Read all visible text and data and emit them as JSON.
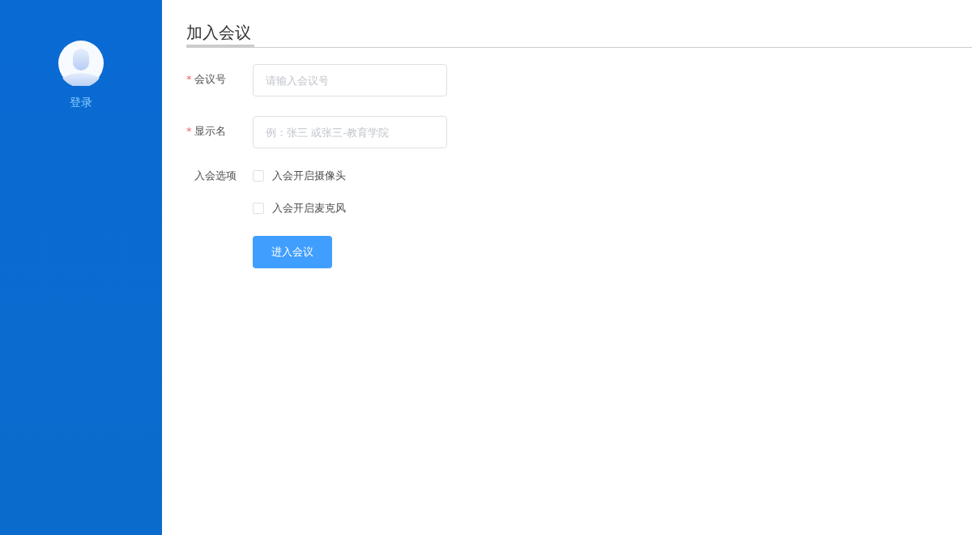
{
  "sidebar": {
    "login_label": "登录"
  },
  "page": {
    "title": "加入会议"
  },
  "fields": [
    {
      "mark": "*",
      "label": "会议号",
      "placeholder": "请输入会议号"
    },
    {
      "mark": "*",
      "label": "显示名",
      "placeholder": "例：张三 或张三-教育学院"
    }
  ],
  "options": {
    "label": "入会选项",
    "items": [
      {
        "label": "入会开启摄像头",
        "checked": false
      },
      {
        "label": "入会开启麦克风",
        "checked": false
      }
    ]
  },
  "submit": "进入会议"
}
